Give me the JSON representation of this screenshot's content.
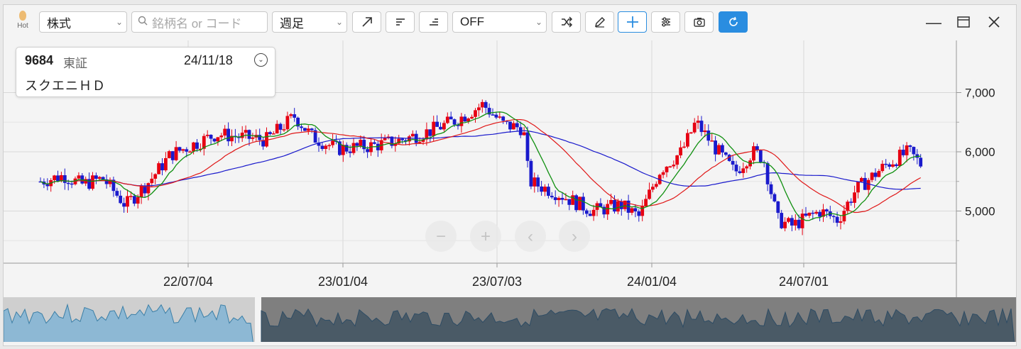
{
  "toolbar": {
    "hot_label": "Hot",
    "market_select": "株式",
    "search_placeholder": "銘柄名 or コード",
    "period_select": "週足",
    "indicator_select": "OFF"
  },
  "info": {
    "code": "9684",
    "exchange": "東証",
    "date": "24/11/18",
    "name": "スクエニＨＤ"
  },
  "chart_data": {
    "type": "candlestick",
    "y_ticks": [
      "7,000",
      "6,000",
      "5,000"
    ],
    "x_ticks": [
      "22/07/04",
      "23/01/04",
      "23/07/03",
      "24/01/04",
      "24/07/01"
    ],
    "colors": {
      "up": "#e60012",
      "down": "#1a1acc",
      "ma_short": "#109010",
      "ma_mid": "#e01818",
      "ma_long": "#1a1acc"
    }
  },
  "nav": {
    "zoom_out": "−",
    "zoom_in": "+",
    "prev": "‹",
    "next": "›"
  }
}
